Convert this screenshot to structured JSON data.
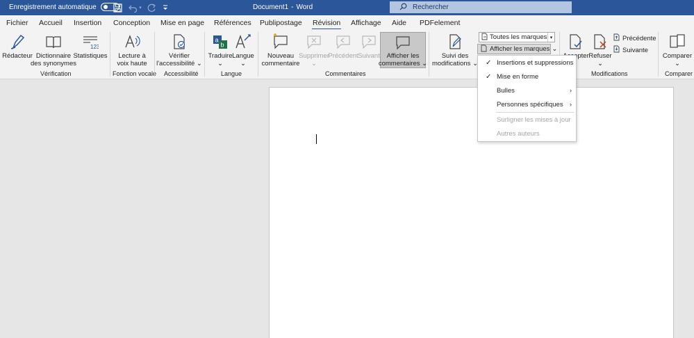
{
  "titlebar": {
    "autosave_label": "Enregistrement automatique",
    "doc_name": "Document1",
    "separator": "-",
    "app_name": "Word",
    "search_placeholder": "Rechercher"
  },
  "menu": {
    "tabs": [
      {
        "label": "Fichier"
      },
      {
        "label": "Accueil"
      },
      {
        "label": "Insertion"
      },
      {
        "label": "Conception"
      },
      {
        "label": "Mise en page"
      },
      {
        "label": "Références"
      },
      {
        "label": "Publipostage"
      },
      {
        "label": "Révision",
        "active": true
      },
      {
        "label": "Affichage"
      },
      {
        "label": "Aide"
      },
      {
        "label": "PDFelement"
      }
    ]
  },
  "ribbon": {
    "verification": {
      "redacteur": "Rédacteur",
      "dictionnaire_1": "Dictionnaire",
      "dictionnaire_2": "des synonymes",
      "statistiques": "Statistiques",
      "group": "Vérification"
    },
    "vocale": {
      "lecture_1": "Lecture à",
      "lecture_2": "voix haute",
      "group": "Fonction vocale"
    },
    "accessibilite": {
      "verifier_1": "Vérifier",
      "verifier_2": "l'accessibilité",
      "group": "Accessibilité"
    },
    "langue": {
      "traduire": "Traduire",
      "langue": "Langue",
      "group": "Langue"
    },
    "commentaires": {
      "nouveau_1": "Nouveau",
      "nouveau_2": "commentaire",
      "supprimer": "Supprimer",
      "precedent": "Précédent",
      "suivant": "Suivant",
      "afficher_1": "Afficher les",
      "afficher_2": "commentaires",
      "group": "Commentaires"
    },
    "suivi": {
      "suivi_1": "Suivi des",
      "suivi_2": "modifications",
      "combo_value": "Toutes les marques",
      "markup_button": "Afficher les marques"
    },
    "modifications": {
      "accepter": "Accepter",
      "refuser": "Refuser",
      "precedente": "Précédente",
      "suivante": "Suivante",
      "group": "Modifications"
    },
    "comparer": {
      "comparer": "Comparer",
      "group": "Comparer"
    }
  },
  "dropdown": {
    "items": [
      {
        "label": "Insertions et suppressions",
        "checked": true,
        "enabled": true
      },
      {
        "label": "Mise en forme",
        "checked": true,
        "enabled": true
      },
      {
        "label": "Bulles",
        "submenu": true,
        "enabled": true
      },
      {
        "label": "Personnes spécifiques",
        "submenu": true,
        "enabled": true
      },
      {
        "label": "Surligner les mises à jour",
        "enabled": false
      },
      {
        "label": "Autres auteurs",
        "enabled": false
      }
    ]
  },
  "glyphs": {
    "check": "✓",
    "submenu": "›",
    "dropdown": "⌄",
    "combo_arrow": "▾"
  },
  "colors": {
    "titlebar": "#2b579a",
    "accent": "#2b579a",
    "ribbon": "#f3f3f3",
    "canvas": "#e6e6e6"
  }
}
